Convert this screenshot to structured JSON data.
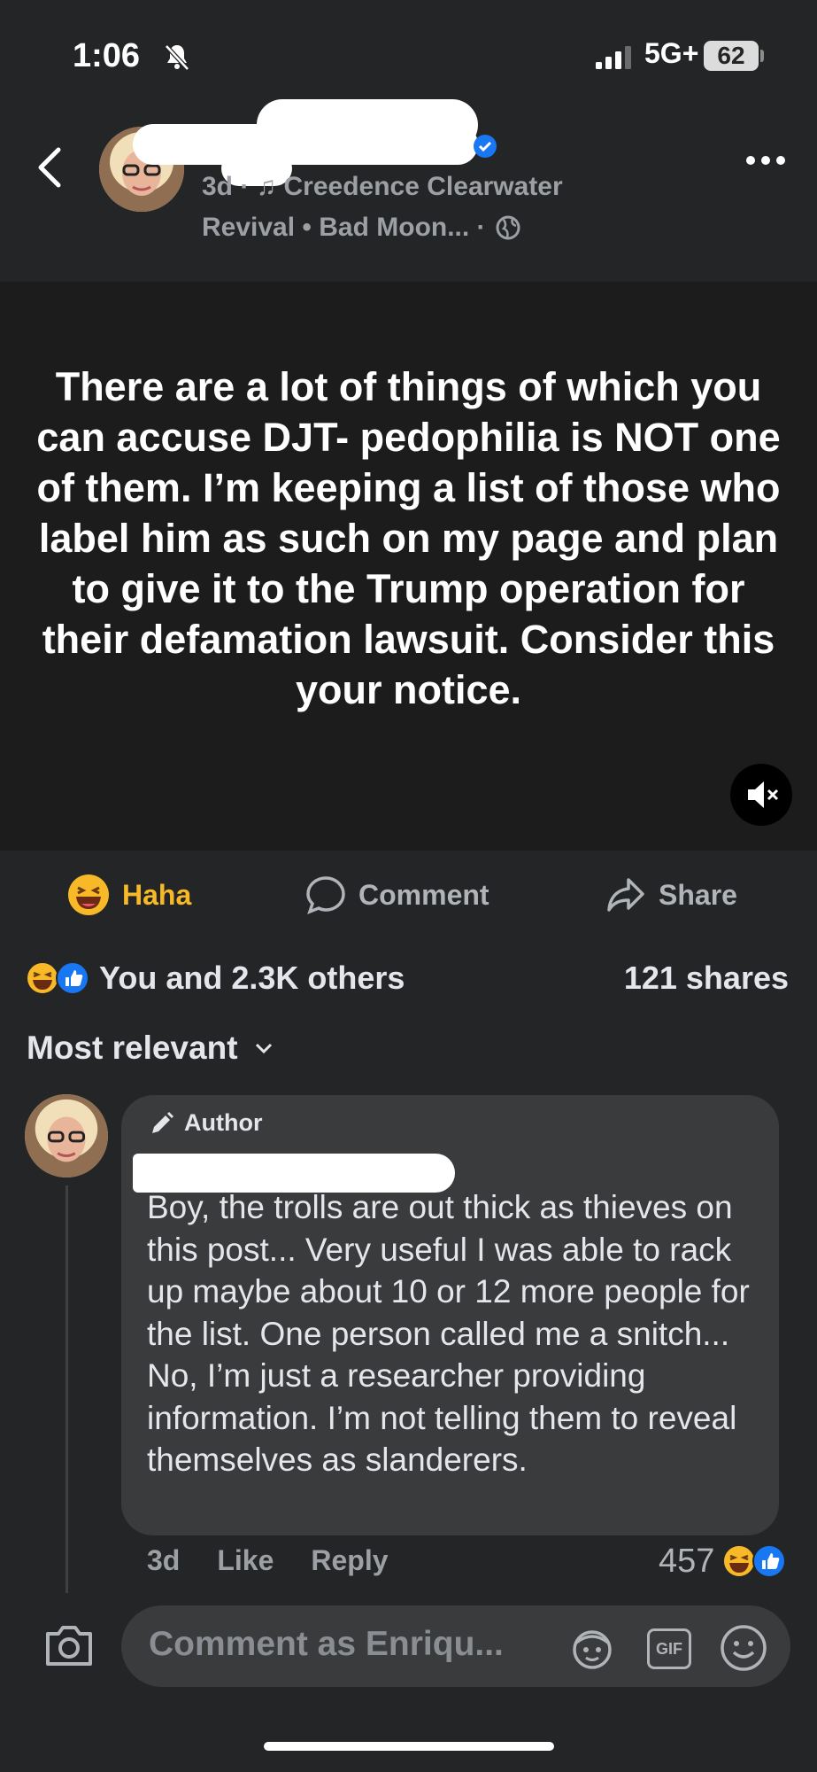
{
  "status_bar": {
    "time": "1:06",
    "network": "5G+",
    "battery": "62"
  },
  "header": {
    "meta_line1": "3d · ♫ Creedence Clearwater",
    "meta_line2": "Revival • Bad Moon... ·",
    "icons": [
      "back-chevron-icon",
      "verified-badge-icon",
      "globe-icon",
      "more-options-icon"
    ]
  },
  "post": {
    "text": "There are a lot of things of which you can accuse DJT- pedophilia is NOT one of them. I’m keeping a list of those who label him as such on my page and plan to give it to the Trump operation for their defamation lawsuit. Consider this your notice."
  },
  "actions": {
    "haha_label": "Haha",
    "comment_label": "Comment",
    "share_label": "Share"
  },
  "reactions": {
    "summary": "You and 2.3K others",
    "shares": "121 shares"
  },
  "comments_sort": {
    "label": "Most relevant"
  },
  "comment": {
    "badge": "Author",
    "text": "Boy, the trolls are out thick as thieves on this post... Very useful I was able to rack up maybe about 10 or 12 more people for the list. One person called me a snitch... No, I’m just a researcher providing information. I’m not telling them to reveal themselves as slanderers.",
    "time": "3d",
    "like_label": "Like",
    "reply_label": "Reply",
    "reaction_count": "457"
  },
  "composer": {
    "placeholder": "Comment as Enriqu...",
    "gif_label": "GIF"
  },
  "colors": {
    "background": "#242526",
    "post_background": "#1c1c1d",
    "haha_yellow": "#f7b928",
    "like_blue": "#1877f2",
    "bubble": "#3a3b3c"
  }
}
